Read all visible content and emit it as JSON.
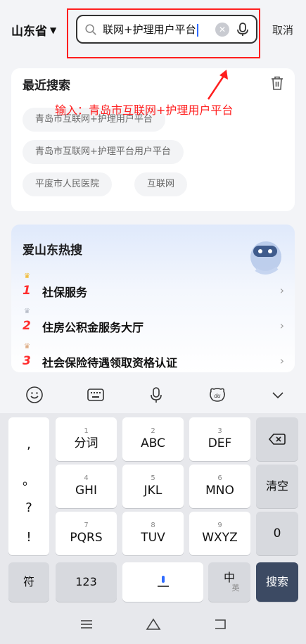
{
  "header": {
    "province": "山东省",
    "query": "联网+护理用户平台",
    "cancel": "取消"
  },
  "recent": {
    "title": "最近搜索",
    "tags": [
      "青岛市互联网+护理用户平台",
      "青岛市互联网+护理平台用户平台",
      "平度市人民医院",
      "互联网"
    ]
  },
  "annotation": "输入：青岛市互联网+护理用户平台",
  "hot": {
    "title": "爱山东热搜",
    "items": [
      {
        "rank": "1",
        "label": "社保服务"
      },
      {
        "rank": "2",
        "label": "住房公积金服务大厅"
      },
      {
        "rank": "3",
        "label": "社会保险待遇领取资格认证"
      }
    ]
  },
  "keyboard": {
    "punct": [
      ",",
      "。",
      "?",
      "!"
    ],
    "keys": [
      {
        "num": "1",
        "txt": "分词"
      },
      {
        "num": "2",
        "txt": "ABC"
      },
      {
        "num": "3",
        "txt": "DEF"
      },
      {
        "num": "4",
        "txt": "GHI"
      },
      {
        "num": "5",
        "txt": "JKL"
      },
      {
        "num": "6",
        "txt": "MNO"
      },
      {
        "num": "7",
        "txt": "PQRS"
      },
      {
        "num": "8",
        "txt": "TUV"
      },
      {
        "num": "9",
        "txt": "WXYZ"
      }
    ],
    "clear": "清空",
    "zero": "0",
    "symbols": "符",
    "numbers": "123",
    "lang_main": "中",
    "lang_sub": "英",
    "search": "搜索"
  },
  "colors": {
    "accent": "#2f6bff",
    "annotation_red": "#ff1e1e",
    "search_key": "#3c4a63"
  }
}
